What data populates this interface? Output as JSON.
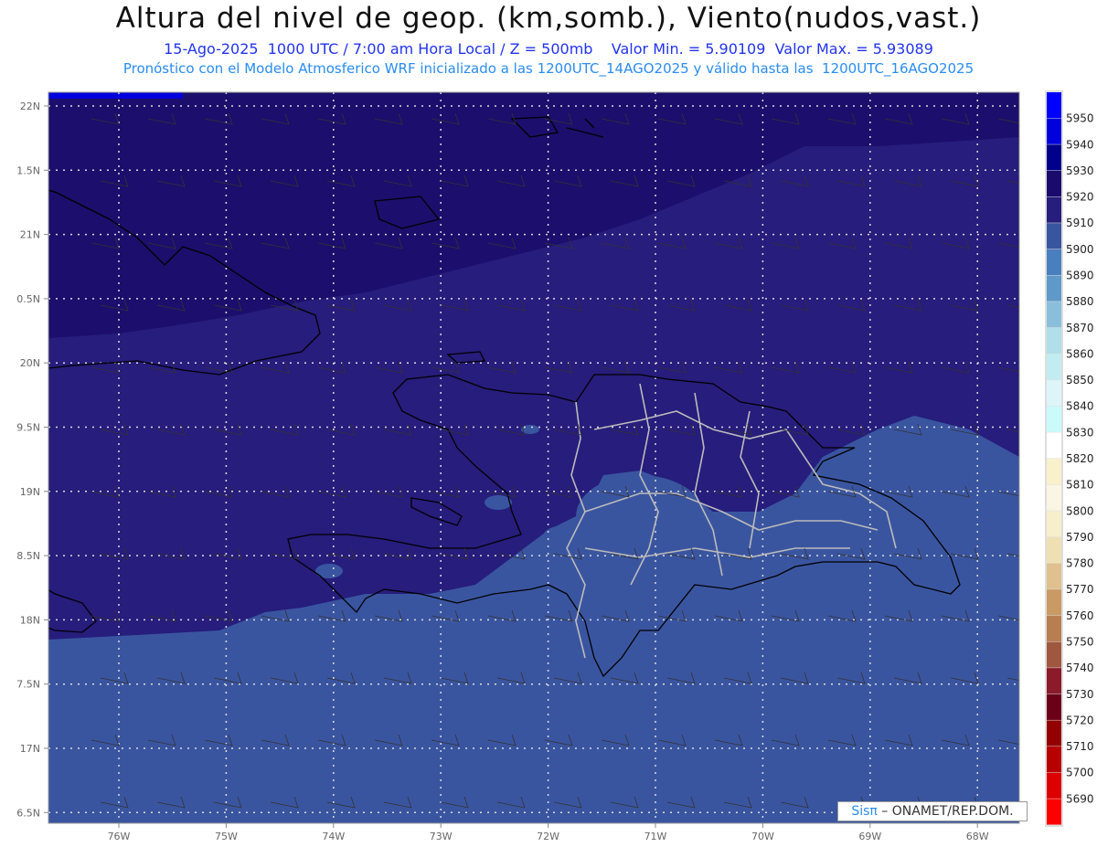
{
  "title": "Altura del nivel de geop. (km,somb.), Viento(nudos,vast.)",
  "subtitle": "15-Ago-2025  1000 UTC / 7:00 am Hora Local / Z = 500mb    Valor Min. = 5.90109  Valor Max. = 5.93089",
  "info": "Pronóstico con el Modelo Atmosferico WRF inicializado a las 1200UTC_14AGO2025 y válido hasta las  1200UTC_16AGO2025",
  "lat_labels": [
    "22N",
    "1.5N",
    "21N",
    "0.5N",
    "20N",
    "9.5N",
    "19N",
    "8.5N",
    "18N",
    "7.5N",
    "17N",
    "6.5N"
  ],
  "lon_labels": [
    "76W",
    "75W",
    "74W",
    "73W",
    "72W",
    "71W",
    "70W",
    "69W",
    "68W"
  ],
  "legend": {
    "labels": [
      "5950",
      "5940",
      "5930",
      "5920",
      "5910",
      "5900",
      "5890",
      "5880",
      "5870",
      "5860",
      "5850",
      "5840",
      "5830",
      "5820",
      "5810",
      "5800",
      "5790",
      "5780",
      "5770",
      "5760",
      "5750",
      "5740",
      "5730",
      "5720",
      "5710",
      "5700",
      "5690"
    ],
    "colors": [
      "#0000ff",
      "#0000dd",
      "#00008c",
      "#1a0a6c",
      "#261d7c",
      "#3a55a0",
      "#4a7fbf",
      "#5f99c9",
      "#8abfdc",
      "#b0dfea",
      "#c3ecf2",
      "#ddf5f8",
      "#cbfafb",
      "#ffffff",
      "#f8f1cc",
      "#fbf5e3",
      "#f7eecb",
      "#efe0b4",
      "#dfc08e",
      "#c99a63",
      "#b97e50",
      "#a0573f",
      "#8b1a2a",
      "#6b0019",
      "#930000",
      "#b80000",
      "#dd0000",
      "#ff0000"
    ]
  },
  "credit": {
    "brand": "Sisπ",
    "text": " – ONAMET/REP.DOM."
  }
}
